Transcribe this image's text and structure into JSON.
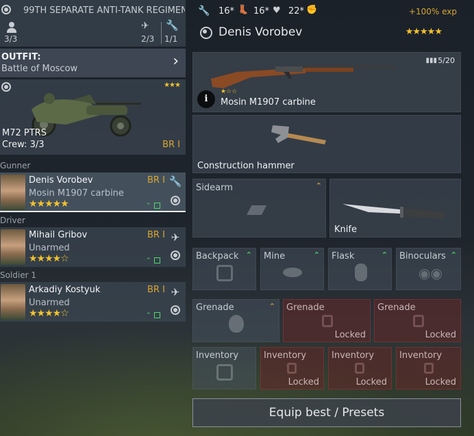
{
  "unit": {
    "title": "99TH SEPARATE ANTI-TANK REGIMEN",
    "crew_count": "3/3",
    "fighters_count": "2/3",
    "mechanics_count": "1/1"
  },
  "outfit": {
    "label": "OUTFIT:",
    "value": "Battle of Moscow"
  },
  "vehicle": {
    "name": "M72 PTRS",
    "crew_label": "Crew: 3/3",
    "br": "BR I",
    "stars": "★★★"
  },
  "crew_sections": [
    {
      "role": "Gunner",
      "name": "Denis Vorobev",
      "weapon": "Mosin M1907 carbine",
      "br": "BR I",
      "stars": "★★★★★",
      "side_icon": "wrench-icon"
    },
    {
      "role": "Driver",
      "name": "Mihail Gribov",
      "weapon": "Unarmed",
      "br": "BR I",
      "stars": "★★★★☆",
      "side_icon": "wings-icon"
    },
    {
      "role": "Soldier 1",
      "name": "Arkadiy Kostyuk",
      "weapon": "Unarmed",
      "br": "BR I",
      "stars": "★★★★☆",
      "side_icon": "wings-icon"
    }
  ],
  "stats": {
    "s1": "16*",
    "s2": "16*",
    "s3": "22*",
    "exp_bonus": "+100% exp"
  },
  "soldier": {
    "name": "Denis Vorobev",
    "stars": "★★★★★"
  },
  "primary": {
    "name": "Mosin M1907 carbine",
    "ammo": "5/20",
    "stars": "★☆☆"
  },
  "tool": {
    "name": "Construction hammer"
  },
  "sidearm": {
    "label": "Sidearm"
  },
  "melee": {
    "name": "Knife"
  },
  "equipment": [
    {
      "label": "Backpack"
    },
    {
      "label": "Mine"
    },
    {
      "label": "Flask"
    },
    {
      "label": "Binoculars"
    }
  ],
  "grenades": [
    {
      "label": "Grenade",
      "locked_text": ""
    },
    {
      "label": "Grenade",
      "locked_text": "Locked"
    },
    {
      "label": "Grenade",
      "locked_text": "Locked"
    }
  ],
  "inventory": [
    {
      "label": "Inventory",
      "locked_text": ""
    },
    {
      "label": "Inventory",
      "locked_text": "Locked"
    },
    {
      "label": "Inventory",
      "locked_text": "Locked"
    },
    {
      "label": "Inventory",
      "locked_text": "Locked"
    }
  ],
  "equip_button": "Equip best / Presets",
  "colors": {
    "accent_gold": "#d8a532",
    "upgrade_green": "#4fd86c",
    "locked_red": "#5f2828",
    "star_yellow": "#f2c22d"
  }
}
